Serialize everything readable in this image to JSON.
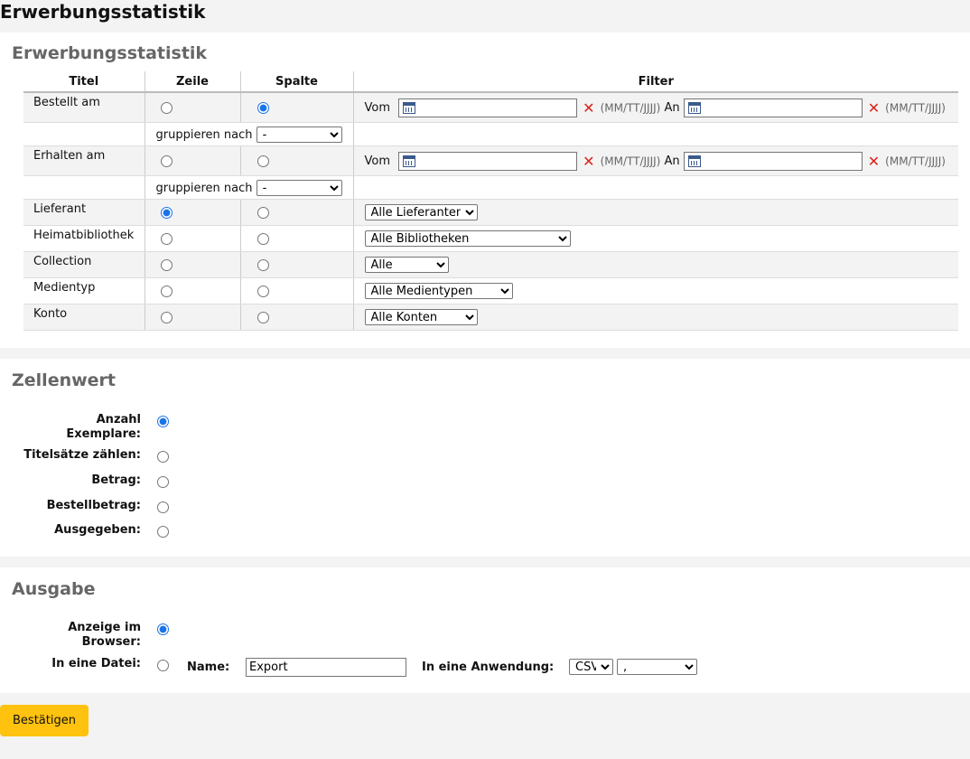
{
  "page": {
    "title": "Erwerbungsstatistik"
  },
  "criteria": {
    "heading": "Erwerbungsstatistik",
    "headers": {
      "title": "Titel",
      "row": "Zeile",
      "column": "Spalte",
      "filter": "Filter"
    },
    "ordered": {
      "label": "Bestellt am",
      "from": "Vom",
      "to": "An",
      "hint": "(MM/TT/JJJJ)",
      "group_label": "gruppieren nach",
      "group_value": "-"
    },
    "received": {
      "label": "Erhalten am",
      "from": "Vom",
      "to": "An",
      "hint": "(MM/TT/JJJJ)",
      "group_label": "gruppieren nach",
      "group_value": "-"
    },
    "vendor": {
      "label": "Lieferant",
      "select": "Alle Lieferanten"
    },
    "library": {
      "label": "Heimatbibliothek",
      "select": "Alle Bibliotheken"
    },
    "collection": {
      "label": "Collection",
      "select": "Alle"
    },
    "itemtype": {
      "label": "Medientyp",
      "select": "Alle Medientypen"
    },
    "account": {
      "label": "Konto",
      "select": "Alle Konten"
    }
  },
  "cellvalue": {
    "heading": "Zellenwert",
    "options": [
      {
        "label": "Anzahl Exemplare:",
        "checked": true
      },
      {
        "label": "Titelsätze zählen:",
        "checked": false
      },
      {
        "label": "Betrag:",
        "checked": false
      },
      {
        "label": "Bestellbetrag:",
        "checked": false
      },
      {
        "label": "Ausgegeben:",
        "checked": false
      }
    ]
  },
  "output": {
    "heading": "Ausgabe",
    "browser_label": "Anzeige im Browser:",
    "file_label": "In eine Datei:",
    "name_label": "Name:",
    "name_value": "Export",
    "app_label": "In eine Anwendung:",
    "format_value": "CSV",
    "delimiter_value": ","
  },
  "submit_label": "Bestätigen",
  "colors": {
    "accent": "#ffc20e",
    "clear": "#d9251c",
    "heading": "#666666"
  }
}
